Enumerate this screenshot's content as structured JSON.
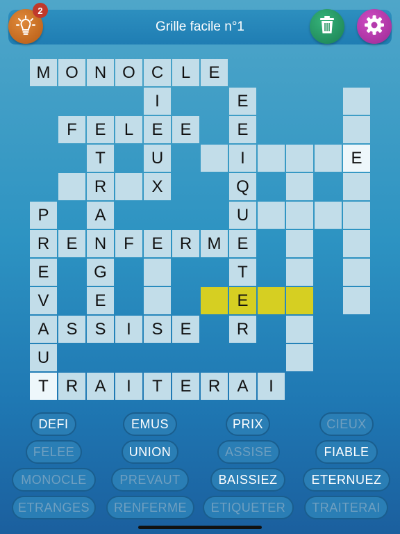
{
  "header": {
    "title": "Grille facile n°1",
    "hint_count": "2",
    "icons": {
      "hint": "lightbulb-icon",
      "delete": "trash-icon",
      "settings": "gear-icon"
    },
    "colors": {
      "hint": "#c46a22",
      "delete": "#22925f",
      "settings": "#b43aac"
    }
  },
  "grid": {
    "cells": [
      {
        "r": 0,
        "c": 0,
        "ch": "M"
      },
      {
        "r": 0,
        "c": 1,
        "ch": "O"
      },
      {
        "r": 0,
        "c": 2,
        "ch": "N"
      },
      {
        "r": 0,
        "c": 3,
        "ch": "O"
      },
      {
        "r": 0,
        "c": 4,
        "ch": "C"
      },
      {
        "r": 0,
        "c": 5,
        "ch": "L"
      },
      {
        "r": 0,
        "c": 6,
        "ch": "E"
      },
      {
        "r": 1,
        "c": 4,
        "ch": "I"
      },
      {
        "r": 1,
        "c": 7,
        "ch": "E"
      },
      {
        "r": 1,
        "c": 11,
        "ch": ""
      },
      {
        "r": 2,
        "c": 1,
        "ch": "F"
      },
      {
        "r": 2,
        "c": 2,
        "ch": "E"
      },
      {
        "r": 2,
        "c": 3,
        "ch": "L"
      },
      {
        "r": 2,
        "c": 4,
        "ch": "E"
      },
      {
        "r": 2,
        "c": 5,
        "ch": "E"
      },
      {
        "r": 2,
        "c": 7,
        "ch": "E"
      },
      {
        "r": 2,
        "c": 11,
        "ch": ""
      },
      {
        "r": 3,
        "c": 2,
        "ch": "T"
      },
      {
        "r": 3,
        "c": 4,
        "ch": "U"
      },
      {
        "r": 3,
        "c": 6,
        "ch": ""
      },
      {
        "r": 3,
        "c": 7,
        "ch": "I"
      },
      {
        "r": 3,
        "c": 8,
        "ch": ""
      },
      {
        "r": 3,
        "c": 9,
        "ch": ""
      },
      {
        "r": 3,
        "c": 10,
        "ch": ""
      },
      {
        "r": 3,
        "c": 11,
        "ch": "E",
        "state": "sel"
      },
      {
        "r": 4,
        "c": 1,
        "ch": ""
      },
      {
        "r": 4,
        "c": 2,
        "ch": "R"
      },
      {
        "r": 4,
        "c": 3,
        "ch": ""
      },
      {
        "r": 4,
        "c": 4,
        "ch": "X"
      },
      {
        "r": 4,
        "c": 7,
        "ch": "Q"
      },
      {
        "r": 4,
        "c": 9,
        "ch": ""
      },
      {
        "r": 4,
        "c": 11,
        "ch": ""
      },
      {
        "r": 5,
        "c": 0,
        "ch": "P"
      },
      {
        "r": 5,
        "c": 2,
        "ch": "A"
      },
      {
        "r": 5,
        "c": 7,
        "ch": "U"
      },
      {
        "r": 5,
        "c": 8,
        "ch": ""
      },
      {
        "r": 5,
        "c": 9,
        "ch": ""
      },
      {
        "r": 5,
        "c": 10,
        "ch": ""
      },
      {
        "r": 5,
        "c": 11,
        "ch": ""
      },
      {
        "r": 6,
        "c": 0,
        "ch": "R"
      },
      {
        "r": 6,
        "c": 1,
        "ch": "E"
      },
      {
        "r": 6,
        "c": 2,
        "ch": "N"
      },
      {
        "r": 6,
        "c": 3,
        "ch": "F"
      },
      {
        "r": 6,
        "c": 4,
        "ch": "E"
      },
      {
        "r": 6,
        "c": 5,
        "ch": "R"
      },
      {
        "r": 6,
        "c": 6,
        "ch": "M"
      },
      {
        "r": 6,
        "c": 7,
        "ch": "E"
      },
      {
        "r": 6,
        "c": 9,
        "ch": ""
      },
      {
        "r": 6,
        "c": 11,
        "ch": ""
      },
      {
        "r": 7,
        "c": 0,
        "ch": "E"
      },
      {
        "r": 7,
        "c": 2,
        "ch": "G"
      },
      {
        "r": 7,
        "c": 4,
        "ch": ""
      },
      {
        "r": 7,
        "c": 7,
        "ch": "T"
      },
      {
        "r": 7,
        "c": 9,
        "ch": ""
      },
      {
        "r": 7,
        "c": 11,
        "ch": ""
      },
      {
        "r": 8,
        "c": 0,
        "ch": "V"
      },
      {
        "r": 8,
        "c": 2,
        "ch": "E"
      },
      {
        "r": 8,
        "c": 4,
        "ch": ""
      },
      {
        "r": 8,
        "c": 6,
        "ch": "",
        "state": "hl"
      },
      {
        "r": 8,
        "c": 7,
        "ch": "E",
        "state": "hl"
      },
      {
        "r": 8,
        "c": 8,
        "ch": "",
        "state": "hl"
      },
      {
        "r": 8,
        "c": 9,
        "ch": "",
        "state": "hl"
      },
      {
        "r": 8,
        "c": 11,
        "ch": ""
      },
      {
        "r": 9,
        "c": 0,
        "ch": "A"
      },
      {
        "r": 9,
        "c": 1,
        "ch": "S"
      },
      {
        "r": 9,
        "c": 2,
        "ch": "S"
      },
      {
        "r": 9,
        "c": 3,
        "ch": "I"
      },
      {
        "r": 9,
        "c": 4,
        "ch": "S"
      },
      {
        "r": 9,
        "c": 5,
        "ch": "E"
      },
      {
        "r": 9,
        "c": 7,
        "ch": "R"
      },
      {
        "r": 9,
        "c": 9,
        "ch": ""
      },
      {
        "r": 10,
        "c": 0,
        "ch": "U"
      },
      {
        "r": 10,
        "c": 9,
        "ch": ""
      },
      {
        "r": 11,
        "c": 0,
        "ch": "T",
        "state": "sel"
      },
      {
        "r": 11,
        "c": 1,
        "ch": "R"
      },
      {
        "r": 11,
        "c": 2,
        "ch": "A"
      },
      {
        "r": 11,
        "c": 3,
        "ch": "I"
      },
      {
        "r": 11,
        "c": 4,
        "ch": "T"
      },
      {
        "r": 11,
        "c": 5,
        "ch": "E"
      },
      {
        "r": 11,
        "c": 6,
        "ch": "R"
      },
      {
        "r": 11,
        "c": 7,
        "ch": "A"
      },
      {
        "r": 11,
        "c": 8,
        "ch": "I"
      }
    ]
  },
  "word_bank": {
    "words": [
      {
        "text": "DEFI",
        "used": false
      },
      {
        "text": "EMUS",
        "used": false
      },
      {
        "text": "PRIX",
        "used": false
      },
      {
        "text": "CIEUX",
        "used": true
      },
      {
        "text": "FELEE",
        "used": true
      },
      {
        "text": "UNION",
        "used": false
      },
      {
        "text": "ASSISE",
        "used": true
      },
      {
        "text": "FIABLE",
        "used": false
      },
      {
        "text": "MONOCLE",
        "used": true
      },
      {
        "text": "PREVAUT",
        "used": true
      },
      {
        "text": "BAISSIEZ",
        "used": false
      },
      {
        "text": "ETERNUEZ",
        "used": false
      },
      {
        "text": "ETRANGES",
        "used": true
      },
      {
        "text": "RENFERME",
        "used": true
      },
      {
        "text": "ETIQUETER",
        "used": true
      },
      {
        "text": "TRAITERAI",
        "used": true
      }
    ]
  }
}
